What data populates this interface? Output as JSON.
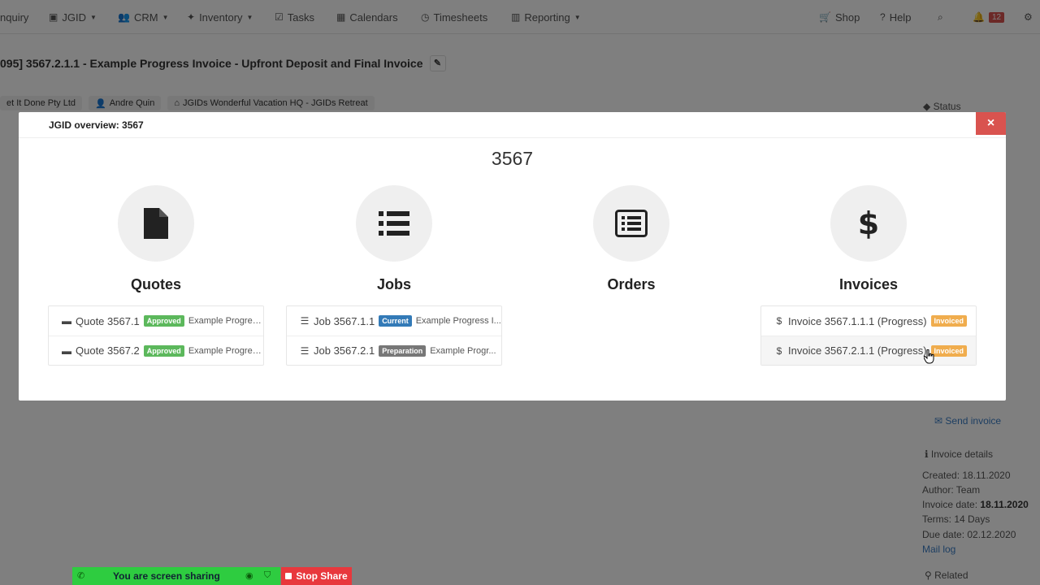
{
  "nav": {
    "items": [
      {
        "label": "nquiry",
        "icon": "",
        "caret": false
      },
      {
        "label": "JGID",
        "icon": "jgid-icon",
        "caret": true
      },
      {
        "label": "CRM",
        "icon": "users-icon",
        "caret": true
      },
      {
        "label": "Inventory",
        "icon": "tools-icon",
        "caret": true
      },
      {
        "label": "Tasks",
        "icon": "checkbox-icon",
        "caret": false
      },
      {
        "label": "Calendars",
        "icon": "calendar-icon",
        "caret": false
      },
      {
        "label": "Timesheets",
        "icon": "clock-icon",
        "caret": false
      },
      {
        "label": "Reporting",
        "icon": "bar-chart-icon",
        "caret": true
      }
    ],
    "shop": "Shop",
    "help": "Help",
    "notifications_count": "12"
  },
  "document": {
    "title": "095] 3567.2.1.1 - Example Progress Invoice - Upfront Deposit and Final Invoice",
    "company": "et It Done Pty Ltd",
    "contact": "Andre Quin",
    "site": "JGIDs Wonderful Vacation HQ - JGIDs Retreat"
  },
  "sidebar": {
    "status_label": "Status",
    "send_invoice": "Send invoice",
    "invoice_details": "Invoice details",
    "created": "Created: 18.11.2020",
    "author": "Author: Team",
    "invoice_date_label": "Invoice date: ",
    "invoice_date_value": "18.11.2020",
    "terms": "Terms: 14 Days",
    "due_date": "Due date: 02.12.2020",
    "mail_log": "Mail log",
    "related": "Related"
  },
  "modal": {
    "title": "JGID overview: 3567",
    "close": "×",
    "jgid_number": "3567",
    "quotes": {
      "title": "Quotes",
      "items": [
        {
          "name": "Quote 3567.1",
          "status": "Approved",
          "desc": "Example Progres..."
        },
        {
          "name": "Quote 3567.2",
          "status": "Approved",
          "desc": "Example Progres..."
        }
      ]
    },
    "jobs": {
      "title": "Jobs",
      "items": [
        {
          "name": "Job 3567.1.1",
          "status": "Current",
          "desc": "Example Progress I..."
        },
        {
          "name": "Job 3567.2.1",
          "status": "Preparation",
          "desc": "Example Progr..."
        }
      ]
    },
    "orders": {
      "title": "Orders",
      "items": []
    },
    "invoices": {
      "title": "Invoices",
      "items": [
        {
          "name": "Invoice 3567.1.1.1 (Progress)",
          "status": "Invoiced"
        },
        {
          "name": "Invoice 3567.2.1.1 (Progress)",
          "status": "Invoiced"
        }
      ]
    }
  },
  "share_bar": {
    "text": "You are screen sharing",
    "stop": "Stop Share"
  },
  "colors": {
    "approved": "#5cb85c",
    "current": "#337ab7",
    "preparation": "#777777",
    "invoiced": "#f0ad4e",
    "close": "#d9534f",
    "share_green": "#2ecc40",
    "stop_red": "#e8383d"
  }
}
